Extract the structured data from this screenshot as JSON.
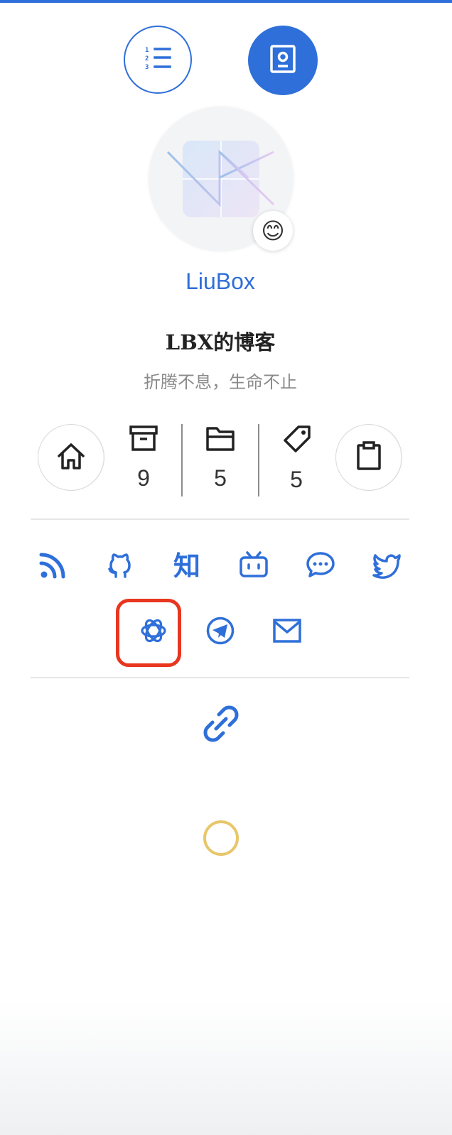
{
  "colors": {
    "accent": "#2f6fd9",
    "highlight": "#e8361f",
    "moon": "#e8c66a",
    "text": "#333333",
    "muted": "#8a8a8a"
  },
  "toolbar": {
    "toc_icon": "ordered-list-icon",
    "overview_icon": "profile-card-icon"
  },
  "author": {
    "name": "LiuBox",
    "status_emoji": "😊"
  },
  "site": {
    "title": "LBX的博客",
    "description": "折腾不息，生命不止"
  },
  "stats": {
    "home_icon": "home-icon",
    "posts": {
      "icon": "archive-icon",
      "count": "9"
    },
    "categories": {
      "icon": "folder-icon",
      "count": "5"
    },
    "tags": {
      "icon": "tag-icon",
      "count": "5"
    },
    "extra_icon": "clipboard-icon"
  },
  "social": {
    "zhihu_label": "知",
    "items": [
      "rss-icon",
      "github-icon",
      "zhihu-icon",
      "bilibili-icon",
      "wechat-icon",
      "twitter-icon",
      "openai-icon",
      "telegram-icon",
      "email-icon"
    ]
  },
  "links_icon": "link-icon",
  "theme_icon": "moon-icon"
}
